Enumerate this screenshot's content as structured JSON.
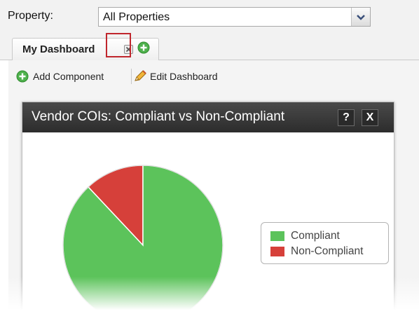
{
  "property": {
    "label": "Property:",
    "selected": "All Properties"
  },
  "tabs": [
    {
      "label": "My Dashboard",
      "active": true
    }
  ],
  "toolbar": {
    "add_component": "Add Component",
    "edit_dashboard": "Edit Dashboard"
  },
  "widget": {
    "title": "Vendor COIs: Compliant vs Non-Compliant",
    "help_label": "?",
    "close_label": "X"
  },
  "icons": {
    "dropdown": "chevron-down-icon",
    "tab_close": "close-icon",
    "add_tab": "plus-circle-icon",
    "add_component": "plus-circle-icon",
    "edit": "pencil-icon"
  },
  "colors": {
    "compliant": "#5cc35b",
    "non_compliant": "#d6403a",
    "highlight": "#c0262d",
    "header": "#333333"
  },
  "chart_data": {
    "type": "pie",
    "categories": [
      "Compliant",
      "Non-Compliant"
    ],
    "values": [
      88,
      12
    ],
    "colors": [
      "#5cc35b",
      "#d6403a"
    ],
    "legend": [
      "Compliant",
      "Non-Compliant"
    ],
    "legend_position": "right"
  }
}
